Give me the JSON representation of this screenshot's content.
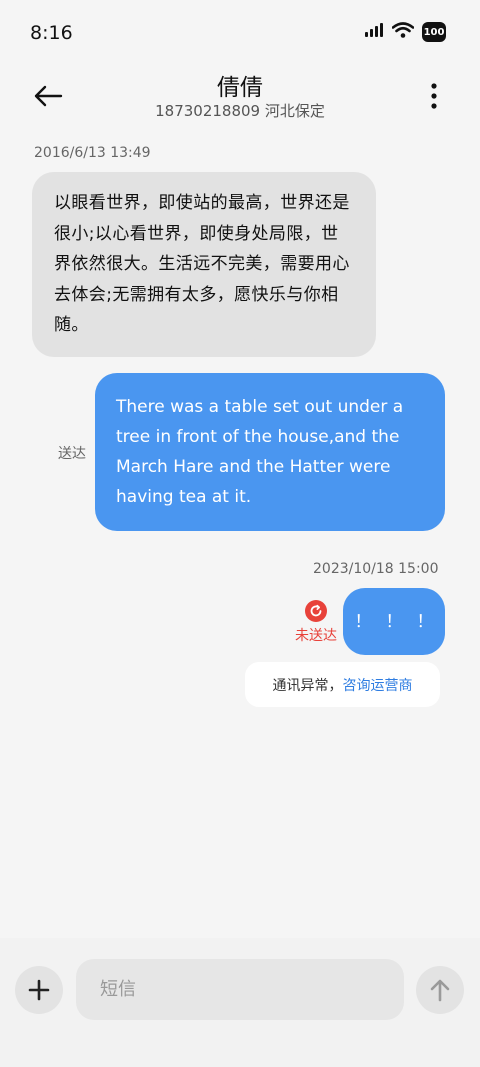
{
  "status_bar": {
    "time": "8:16",
    "icons": [
      "signal-icon",
      "wifi-icon",
      "battery-icon"
    ],
    "battery_level": "100"
  },
  "header": {
    "contact_name": "倩倩",
    "contact_detail": "18730218809 河北保定",
    "icons": [
      "back-arrow-icon",
      "more-vert-icon"
    ]
  },
  "messages": {
    "first_timestamp": "2016/6/13 13:49",
    "received_text": "以眼看世界，即使站的最高，世界还是很小;以心看世界，即使身处局限，世界依然很大。生活远不完美，需要用心去体会;无需拥有太多，愿快乐与你相随。",
    "sent_text": "There was a table set out under a tree in front of the house,and the March Hare and the Hatter were having tea at it.",
    "sent_status": "送达",
    "second_timestamp": "2023/10/18 15:00",
    "failed_text": "！！！",
    "failed_status": "未送达",
    "notice_text": "通讯异常，",
    "notice_link": "咨询运营商"
  },
  "input_bar": {
    "placeholder": "短信",
    "icons": [
      "plus-icon",
      "send-arrow-icon"
    ]
  },
  "colors": {
    "accent_blue": "#4a96f0",
    "error_red": "#e8423a",
    "link_blue": "#2f7de1"
  }
}
